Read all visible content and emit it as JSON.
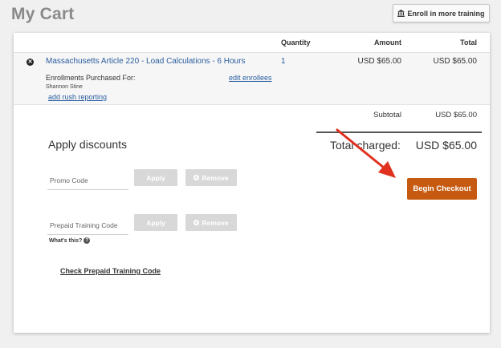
{
  "page": {
    "title": "My Cart"
  },
  "header": {
    "enroll_more_label": "Enroll in more training"
  },
  "cart": {
    "columns": {
      "quantity": "Quantity",
      "amount": "Amount",
      "total": "Total"
    },
    "item": {
      "course": "Massachusetts Article 220 - Load Calculations - 6 Hours",
      "quantity": "1",
      "amount": "USD $65.00",
      "total": "USD $65.00",
      "enrollments_label": "Enrollments Purchased For:",
      "edit_enrollees": "edit enrollees",
      "enrollee": "Shannon Stine",
      "rush_reporting": "add rush reporting"
    },
    "subtotal_label": "Subtotal",
    "subtotal_value": "USD $65.00",
    "total_charged_label": "Total charged:",
    "total_charged_value": "USD $65.00"
  },
  "discounts": {
    "title": "Apply discounts",
    "promo_placeholder": "Promo Code",
    "prepaid_placeholder": "Prepaid Training Code",
    "apply_label": "Apply",
    "remove_label": "Remove",
    "whats_this": "What's this?",
    "check_prepaid": "Check Prepaid Training Code"
  },
  "checkout": {
    "label": "Begin Checkout"
  },
  "colors": {
    "accent": "#c65a10",
    "link": "#2a5d9f",
    "annotation_arrow": "#e0301e"
  },
  "icons": [
    "bank-icon",
    "remove-circle-icon",
    "x-circle-icon",
    "question-icon",
    "annotation-arrow-icon"
  ]
}
